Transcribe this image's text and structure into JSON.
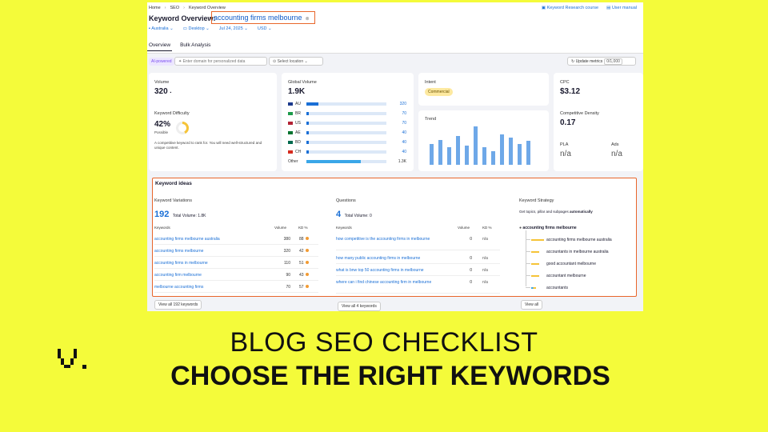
{
  "breadcrumb": [
    "Home",
    "SEO",
    "Keyword Overview"
  ],
  "toplinks": {
    "course": "Keyword Research course",
    "manual": "User manual"
  },
  "title": "Keyword Overview:",
  "keyword": "accounting firms melbourne",
  "filters": {
    "country": "Australia",
    "device": "Desktop",
    "date": "Jul 24, 2025",
    "currency": "USD"
  },
  "tabs": [
    "Overview",
    "Bulk Analysis"
  ],
  "aibar": {
    "tag": "AI-powered",
    "domain_placeholder": "Enter domain for personalized data",
    "location": "Select location",
    "update": "Update metrics",
    "update_count": "0/1,000"
  },
  "volume": {
    "label": "Volume",
    "value": "320"
  },
  "kd": {
    "label": "Keyword Difficulty",
    "value": "42%",
    "level": "Possible",
    "desc": "A competitive keyword to rank for. You will need well-structured and unique content.",
    "percent": 42
  },
  "global_volume": {
    "label": "Global Volume",
    "value": "1.9K",
    "rows": [
      {
        "cc": "AU",
        "num": "320",
        "share": 0.25
      },
      {
        "cc": "BR",
        "num": "70",
        "share": 0.05
      },
      {
        "cc": "US",
        "num": "70",
        "share": 0.05
      },
      {
        "cc": "AE",
        "num": "40",
        "share": 0.03
      },
      {
        "cc": "BD",
        "num": "40",
        "share": 0.03
      },
      {
        "cc": "CH",
        "num": "40",
        "share": 0.03
      }
    ],
    "other_label": "Other",
    "other_num": "1.3K",
    "other_share": 0.68
  },
  "intent": {
    "label": "Intent",
    "value": "Commercial"
  },
  "trend": {
    "label": "Trend",
    "values": [
      0.55,
      0.65,
      0.45,
      0.75,
      0.5,
      1.0,
      0.45,
      0.35,
      0.8,
      0.7,
      0.55,
      0.62
    ]
  },
  "cpc": {
    "label": "CPC",
    "value": "$3.12"
  },
  "comp_density": {
    "label": "Competitive Density",
    "value": "0.17"
  },
  "pla": {
    "label": "PLA",
    "value": "n/a"
  },
  "ads": {
    "label": "Ads",
    "value": "n/a"
  },
  "ideas": {
    "title": "Keyword ideas",
    "variations": {
      "label": "Keyword Variations",
      "count": "192",
      "total": "Total Volume: 1.8K",
      "headers": [
        "Keywords",
        "Volume",
        "KD %"
      ],
      "rows": [
        {
          "kw": "accounting firms melbourne australia",
          "vol": "380",
          "kd": "88"
        },
        {
          "kw": "accounting firms melbourne",
          "vol": "320",
          "kd": "42"
        },
        {
          "kw": "accounting firms in melbourne",
          "vol": "110",
          "kd": "51"
        },
        {
          "kw": "accounting firm melbourne",
          "vol": "90",
          "kd": "43"
        },
        {
          "kw": "melbourne accounting firms",
          "vol": "70",
          "kd": "57"
        }
      ],
      "view_all": "View all 192 keywords"
    },
    "questions": {
      "label": "Questions",
      "count": "4",
      "total": "Total Volume: 0",
      "headers": [
        "Keywords",
        "Volume",
        "KD %"
      ],
      "rows": [
        {
          "kw": "how competitive is the accounting firms in melbourne",
          "vol": "0",
          "kd": "n/a"
        },
        {
          "kw": "how many public accounting firms in melbourne",
          "vol": "0",
          "kd": "n/a"
        },
        {
          "kw": "what is bnw top 50 accounting firms in melbourne",
          "vol": "0",
          "kd": "n/a"
        },
        {
          "kw": "where can i find chinese accounting firm in melbourne",
          "vol": "0",
          "kd": "n/a"
        }
      ],
      "view_all": "View all 4 keywords"
    },
    "strategy": {
      "label": "Keyword Strategy",
      "desc_prefix": "Get topics, pillar and subpages ",
      "desc_bold": "automatically",
      "root": "accounting firms melbourne",
      "items": [
        "accounting firms melbourne australia",
        "accountants in melbourne australia",
        "good accountant melbourne",
        "accountant melbourne",
        "accountants"
      ],
      "view_all": "View all"
    }
  },
  "footer": {
    "line1": "BLOG SEO CHECKLIST",
    "line2": "CHOOSE THE RIGHT KEYWORDS"
  },
  "colors": {
    "background": "#f4fb3a",
    "highlight": "#e8662b",
    "link": "#1a6fd6"
  }
}
